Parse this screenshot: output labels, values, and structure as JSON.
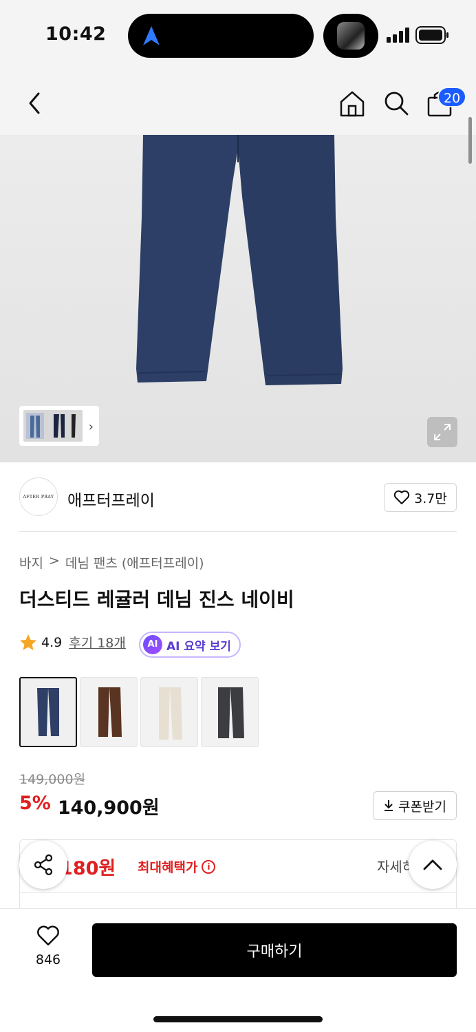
{
  "status_bar": {
    "time": "10:42"
  },
  "nav": {
    "cart_count": "20"
  },
  "brand": {
    "logo_text": "AFTER PRAY",
    "name": "애프터프레이",
    "likes": "3.7만"
  },
  "breadcrumb": {
    "category": "바지",
    "separator": ">",
    "subcategory": "데님 팬츠 (애프터프레이)"
  },
  "product": {
    "title": "더스티드 레귤러 데님 진스 네이비",
    "rating": "4.9",
    "review_label": "후기 18개",
    "ai_badge": "AI",
    "ai_label": "AI 요약 보기",
    "swatch_colors": [
      "#2f3f66",
      "#5a3422",
      "#e7e0d2",
      "#3b3d40"
    ],
    "original_price": "149,000원",
    "discount": "5%",
    "price": "140,900원",
    "coupon_label": "쿠폰받기"
  },
  "benefit": {
    "price": "4,180원",
    "label": "최대혜택가",
    "detail": "자세히"
  },
  "bottom_bar": {
    "wish_count": "846",
    "buy_label": "구매하기"
  },
  "colors": {
    "accent_red": "#e02020",
    "badge_blue": "#1a5cff",
    "ai_purple": "#5b3fcf"
  }
}
